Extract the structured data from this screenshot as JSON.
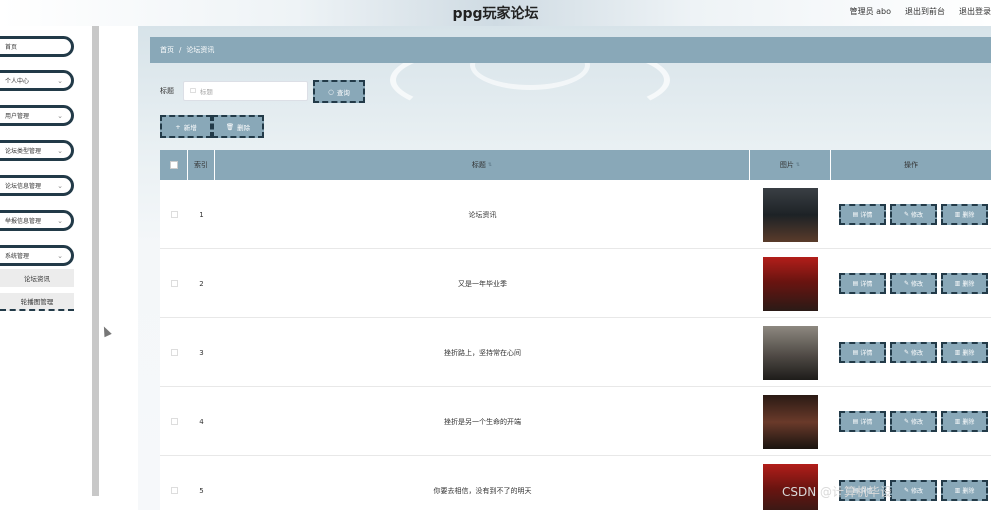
{
  "header": {
    "title": "ppg玩家论坛",
    "user_label": "管理员 abo",
    "front_link": "退出到前台",
    "logout_link": "退出登录"
  },
  "sidebar": {
    "items": [
      {
        "label": "首页",
        "chevron": false
      },
      {
        "label": "个人中心",
        "chevron": true
      },
      {
        "label": "用户管理",
        "chevron": true
      },
      {
        "label": "论坛类型管理",
        "chevron": true
      },
      {
        "label": "论坛信息管理",
        "chevron": true
      },
      {
        "label": "举报信息管理",
        "chevron": true
      },
      {
        "label": "系统管理",
        "chevron": true
      }
    ],
    "submenu": [
      {
        "label": "论坛资讯"
      },
      {
        "label": "轮播图管理"
      }
    ]
  },
  "breadcrumb": {
    "home": "首页",
    "separator": "/",
    "current": "论坛资讯"
  },
  "search": {
    "label": "标题",
    "placeholder": "标题",
    "button_label": "查询"
  },
  "toolbar": {
    "add_label": "新增",
    "delete_label": "删除"
  },
  "table": {
    "headers": {
      "index": "索引",
      "title": "标题",
      "image": "图片",
      "actions": "操作"
    },
    "actions": {
      "detail": "详情",
      "edit": "修改",
      "delete": "删除"
    },
    "rows": [
      {
        "index": "1",
        "title": "论坛资讯",
        "poster": "p-dark"
      },
      {
        "index": "2",
        "title": "又是一年毕业季",
        "poster": "p-red"
      },
      {
        "index": "3",
        "title": "挫折路上，坚持常在心间",
        "poster": "p-gray"
      },
      {
        "index": "4",
        "title": "挫折是另一个生命的开端",
        "poster": "p-brown"
      },
      {
        "index": "5",
        "title": "你要去相信，没有到不了的明天",
        "poster": "p-red"
      }
    ]
  },
  "watermark": "CSDN @计算机毕设",
  "colors": {
    "accent": "#89a8b8",
    "dark_border": "#223a48"
  },
  "icons": {
    "search": "search-icon",
    "add": "plus-icon",
    "delete": "trash-icon",
    "detail": "document-icon",
    "edit": "pencil-icon",
    "chevron": "chevron-down-icon"
  }
}
